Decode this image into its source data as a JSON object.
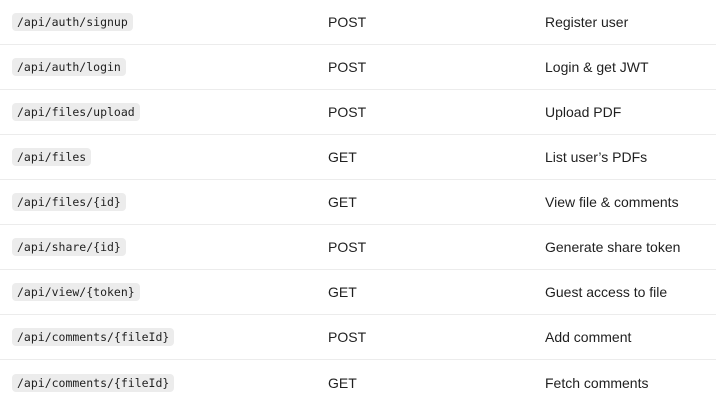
{
  "table": {
    "rows": [
      {
        "endpoint": "/api/auth/signup",
        "method": "POST",
        "description": "Register user"
      },
      {
        "endpoint": "/api/auth/login",
        "method": "POST",
        "description": "Login & get JWT"
      },
      {
        "endpoint": "/api/files/upload",
        "method": "POST",
        "description": "Upload PDF"
      },
      {
        "endpoint": "/api/files",
        "method": "GET",
        "description": "List user’s PDFs"
      },
      {
        "endpoint": "/api/files/{id}",
        "method": "GET",
        "description": "View file & comments"
      },
      {
        "endpoint": "/api/share/{id}",
        "method": "POST",
        "description": "Generate share token"
      },
      {
        "endpoint": "/api/view/{token}",
        "method": "GET",
        "description": "Guest access to file"
      },
      {
        "endpoint": "/api/comments/{fileId}",
        "method": "POST",
        "description": "Add comment"
      },
      {
        "endpoint": "/api/comments/{fileId}",
        "method": "GET",
        "description": "Fetch comments"
      }
    ]
  }
}
